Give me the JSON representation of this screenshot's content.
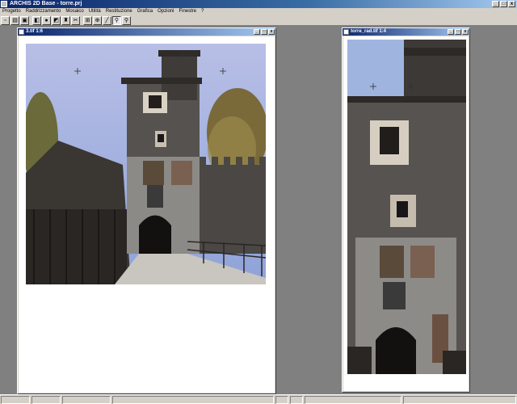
{
  "app": {
    "title": "ARCHIS 2D Base - torre.prj",
    "controls": {
      "minimize": "_",
      "maximize": "□",
      "close": "x"
    }
  },
  "menu": [
    "Progetto",
    "Raddrizzamento",
    "Mosaico",
    "Utilità",
    "Restituzione",
    "Grafica",
    "Opzioni",
    "Finestre",
    "?"
  ],
  "toolbar": {
    "buttons": [
      {
        "icon": "new-icon",
        "glyph": "▫"
      },
      {
        "icon": "open-icon",
        "glyph": "▤"
      },
      {
        "icon": "save-icon",
        "glyph": "▣"
      },
      {
        "icon": "import-image-icon",
        "glyph": "◧"
      },
      {
        "icon": "camera-icon",
        "glyph": "●"
      },
      {
        "icon": "rectify-icon",
        "glyph": "◩"
      },
      {
        "icon": "tower-icon",
        "glyph": "♜"
      },
      {
        "icon": "cut-icon",
        "glyph": "✂"
      },
      {
        "icon": "measure-icon",
        "glyph": "⊞"
      },
      {
        "icon": "point-icon",
        "glyph": "⊕"
      },
      {
        "icon": "line-icon",
        "glyph": "╱"
      },
      {
        "icon": "zoom-in-icon",
        "glyph": "⚲"
      },
      {
        "icon": "zoom-out-icon",
        "glyph": "⚲"
      }
    ]
  },
  "windows": [
    {
      "title": "3.tif 1:6"
    },
    {
      "title": "torre_rad.tif 1:4"
    }
  ],
  "status": [
    "",
    "",
    "",
    "",
    "",
    "",
    "",
    ""
  ]
}
